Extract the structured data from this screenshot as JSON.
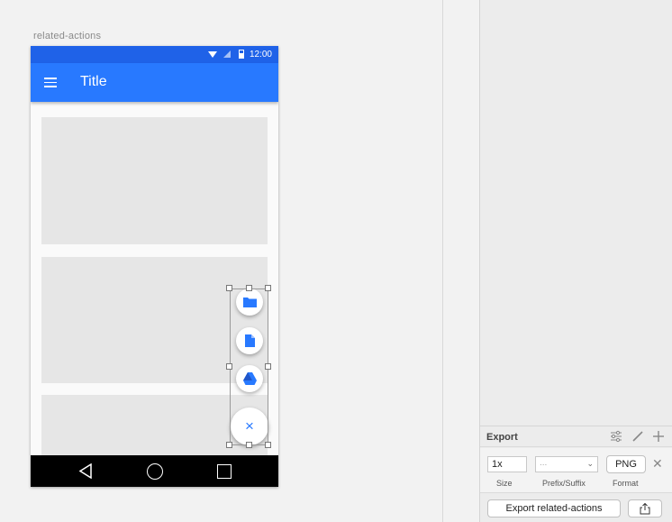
{
  "artboard": {
    "label": "related-actions"
  },
  "status_bar": {
    "time": "12:00"
  },
  "app_bar": {
    "title": "Title"
  },
  "fab": {
    "close_glyph": "×"
  },
  "export": {
    "title": "Export",
    "size_value": "1x",
    "prefix_placeholder": "...",
    "format_value": "PNG",
    "size_label": "Size",
    "prefix_label": "Prefix/Suffix",
    "format_label": "Format",
    "export_button_label": "Export related-actions"
  },
  "colors": {
    "status_bar": "#1f62e8",
    "app_bar": "#2879ff",
    "accent": "#2879ff"
  },
  "icons": [
    "menu-icon",
    "wifi-icon",
    "signal-icon",
    "battery-icon",
    "folder-icon",
    "file-icon",
    "drive-icon",
    "close-icon",
    "back-icon",
    "home-icon",
    "recents-icon",
    "settings-sliders-icon",
    "pen-icon",
    "plus-icon",
    "share-icon"
  ]
}
